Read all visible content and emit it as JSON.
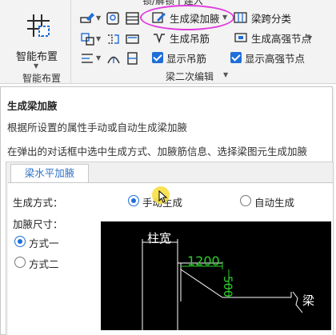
{
  "ribbon": {
    "big_button_label": "智能布置",
    "group_label": "智能布置",
    "subgroup_label": "梁二次编辑",
    "generate_haunch_label": "生成梁加腋",
    "span_classify_label": "梁跨分类",
    "generate_hanger_label": "生成吊筋",
    "generate_high_node_label": "生成高强节点",
    "show_hanger_label": "显示吊筋",
    "show_high_node_label": "显示高强节点",
    "cropped_top_text": "锁/解锁 | 建入",
    "accent_color": "#1e6fd9",
    "highlight_color": "#e23adf"
  },
  "tooltip": {
    "title": "生成梁加腋",
    "description_1": "根据所设置的属性手动或自动生成梁加腋",
    "description_2": "在弹出的对话框中选中生成方式、加腋筋信息、选择梁图元生成加腋"
  },
  "dialog": {
    "tab_label": "梁水平加腋",
    "method_label": "生成方式：",
    "manual_label": "手动生成",
    "auto_label": "自动生成",
    "size_label": "加腋尺寸：",
    "option1_label": "方式一",
    "option2_label": "方式二"
  },
  "diagram": {
    "column_width_label": "柱宽",
    "dimension_h": "1200",
    "dimension_v": "500",
    "beam_label": "梁"
  }
}
